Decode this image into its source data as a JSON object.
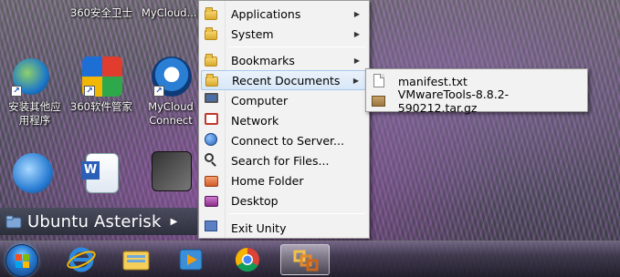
{
  "desktop": {
    "top_labels": [
      "360安全卫士",
      "MyCloud..."
    ],
    "icons": [
      {
        "label_line1": "安装其他应",
        "label_line2": "用程序"
      },
      {
        "label_line1": "360软件管家",
        "label_line2": ""
      },
      {
        "label_line1": "MyCloud",
        "label_line2": "Connect"
      }
    ]
  },
  "unity_bar": {
    "title": "Ubuntu Asterisk"
  },
  "main_menu": {
    "items": [
      {
        "label": "Applications",
        "submenu": true
      },
      {
        "label": "System",
        "submenu": true
      },
      {
        "label": "Bookmarks",
        "submenu": true
      },
      {
        "label": "Recent Documents",
        "submenu": true
      },
      {
        "label": "Computer",
        "submenu": false
      },
      {
        "label": "Network",
        "submenu": false
      },
      {
        "label": "Connect to Server...",
        "submenu": false
      },
      {
        "label": "Search for Files...",
        "submenu": false
      },
      {
        "label": "Home Folder",
        "submenu": false
      },
      {
        "label": "Desktop",
        "submenu": false
      },
      {
        "label": "Exit Unity",
        "submenu": false
      }
    ]
  },
  "recent_documents": {
    "items": [
      {
        "label": "manifest.txt",
        "icon": "text-file-icon"
      },
      {
        "label": "VMwareTools-8.8.2-590212.tar.gz",
        "icon": "archive-icon"
      }
    ]
  },
  "taskbar": {
    "buttons": [
      "start-button",
      "internet-explorer",
      "file-explorer",
      "media-player",
      "chrome",
      "vmware-unity"
    ]
  }
}
